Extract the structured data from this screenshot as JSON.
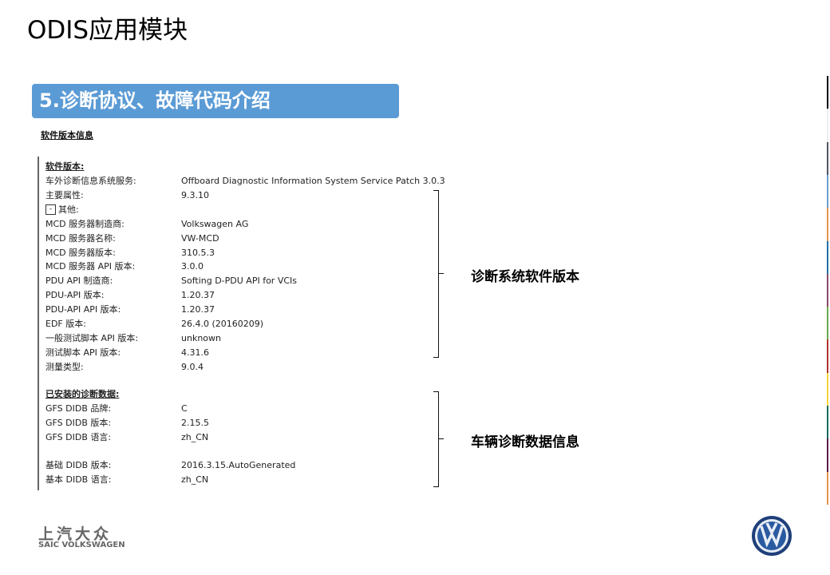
{
  "slide": {
    "title": "ODIS应用模块",
    "banner": "5.诊断协议、故障代码介绍",
    "caption": "软件版本信息"
  },
  "software": {
    "header": "软件版本:",
    "rows": [
      {
        "label": "车外诊断信息系统服务:",
        "value": "Offboard Diagnostic Information System Service  Patch  3.0.3"
      },
      {
        "label": "主要属性:",
        "value": "9.3.10"
      },
      {
        "label": "其他:",
        "value": "",
        "toggle": "-"
      },
      {
        "label": "MCD 服务器制造商:",
        "value": "Volkswagen AG"
      },
      {
        "label": "MCD 服务器名称:",
        "value": "VW-MCD"
      },
      {
        "label": "MCD 服务器版本:",
        "value": "310.5.3"
      },
      {
        "label": "MCD 服务器 API 版本:",
        "value": "3.0.0"
      },
      {
        "label": "PDU API 制造商:",
        "value": "Softing D-PDU API for VCIs"
      },
      {
        "label": "PDU-API 版本:",
        "value": "1.20.37"
      },
      {
        "label": "PDU-API API 版本:",
        "value": "1.20.37"
      },
      {
        "label": "EDF 版本:",
        "value": "26.4.0 (20160209)"
      },
      {
        "label": "一般测试脚本 API 版本:",
        "value": "unknown"
      },
      {
        "label": "测试脚本 API 版本:",
        "value": "4.31.6"
      },
      {
        "label": "测量类型:",
        "value": "9.0.4"
      }
    ]
  },
  "diagdata": {
    "header": "已安装的诊断数据:",
    "rows": [
      {
        "label": "GFS DIDB 品牌:",
        "value": "C"
      },
      {
        "label": "GFS DIDB 版本:",
        "value": "2.15.5"
      },
      {
        "label": "GFS DIDB 语言:",
        "value": "zh_CN"
      },
      {
        "label": "基础 DIDB 版本:",
        "value": "2016.3.15.AutoGenerated"
      },
      {
        "label": "基本 DIDB 语言:",
        "value": "zh_CN"
      }
    ]
  },
  "annotations": {
    "software_version": "诊断系统软件版本",
    "vehicle_data": "车辆诊断数据信息"
  },
  "footer": {
    "brand_cn": "上汽大众",
    "brand_en": "SAIC VOLKSWAGEN"
  },
  "colors": {
    "banner": "#5b9bd5",
    "stripe": [
      "#000000",
      "#eeeeee",
      "#555566",
      "#6a9fd0",
      "#e8954a",
      "#1f6fa8",
      "#8a4a6a",
      "#6aa84f",
      "#b03030",
      "#f2d43a",
      "#1a6a60",
      "#5a1a4a",
      "#e8954a"
    ]
  }
}
